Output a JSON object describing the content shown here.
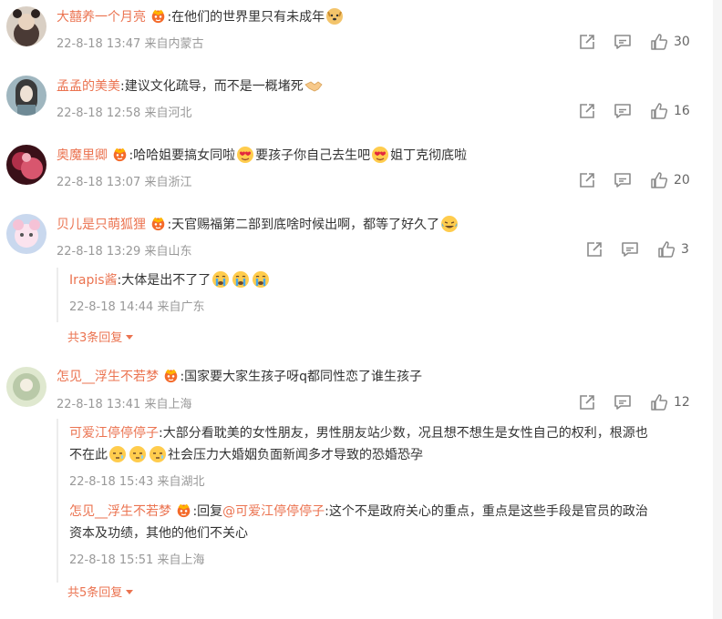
{
  "comments": [
    {
      "user": "大囍养一个月亮",
      "text": ":在他们的世界里只有未成年",
      "time": "22-8-18 13:47",
      "location": "来自内蒙古",
      "likes": "30",
      "avatar_color": "#4a3a35"
    },
    {
      "user": "孟孟的美美",
      "text": ":建议文化疏导，而不是一概堵死",
      "time": "22-8-18 12:58",
      "location": "来自河北",
      "likes": "16",
      "avatar_color": "#6f8a95"
    },
    {
      "user": "奥魔里卿",
      "text_a": ":哈哈姐要搞女同啦",
      "text_b": "要孩子你自己去生吧",
      "text_c": "姐丁克彻底啦",
      "time": "22-8-18 13:07",
      "location": "来自浙江",
      "likes": "20",
      "avatar_color": "#b0304a"
    },
    {
      "user": "贝儿是只萌狐狸",
      "text": ":天官赐福第二部到底啥时候出啊，都等了好久了",
      "time": "22-8-18 13:29",
      "location": "来自山东",
      "likes": "3",
      "avatar_color": "#c9d8ee",
      "replies": [
        {
          "user": "Irapis酱",
          "text": ":大体是出不了了",
          "time": "22-8-18 14:44",
          "location": "来自广东"
        }
      ],
      "more": "共3条回复"
    },
    {
      "user": "怎见__浮生不若梦",
      "text": ":国家要大家生孩子呀q都同性恋了谁生孩子",
      "time": "22-8-18 13:41",
      "location": "来自上海",
      "likes": "12",
      "avatar_color": "#b9c9a8",
      "replies": [
        {
          "user": "可爱江停停停子",
          "text_a": ":大部分看耽美的女性朋友，男性朋友站少数，况且想不想生是女性自己的权利，根源也",
          "text_b": "不在此",
          "text_c": "社会压力大婚姻负面新闻多才导致的恐婚恐孕",
          "time": "22-8-18 15:43",
          "location": "来自湖北"
        },
        {
          "user": "怎见__浮生不若梦",
          "reply_prefix": ":回复",
          "at": "@可爱江停停停子",
          "text_a": ":这个不是政府关心的重点，重点是这些手段是官员的政治",
          "text_b": "资本及功绩，其他的他们不关心",
          "time": "22-8-18 15:51",
          "location": "来自上海"
        }
      ],
      "more": "共5条回复"
    }
  ],
  "icons": {
    "share": "share-icon",
    "comment": "comment-icon",
    "like": "like-icon",
    "vip": "vip-badge-icon"
  },
  "colors": {
    "accent": "#eb7350",
    "meta": "#999999"
  }
}
